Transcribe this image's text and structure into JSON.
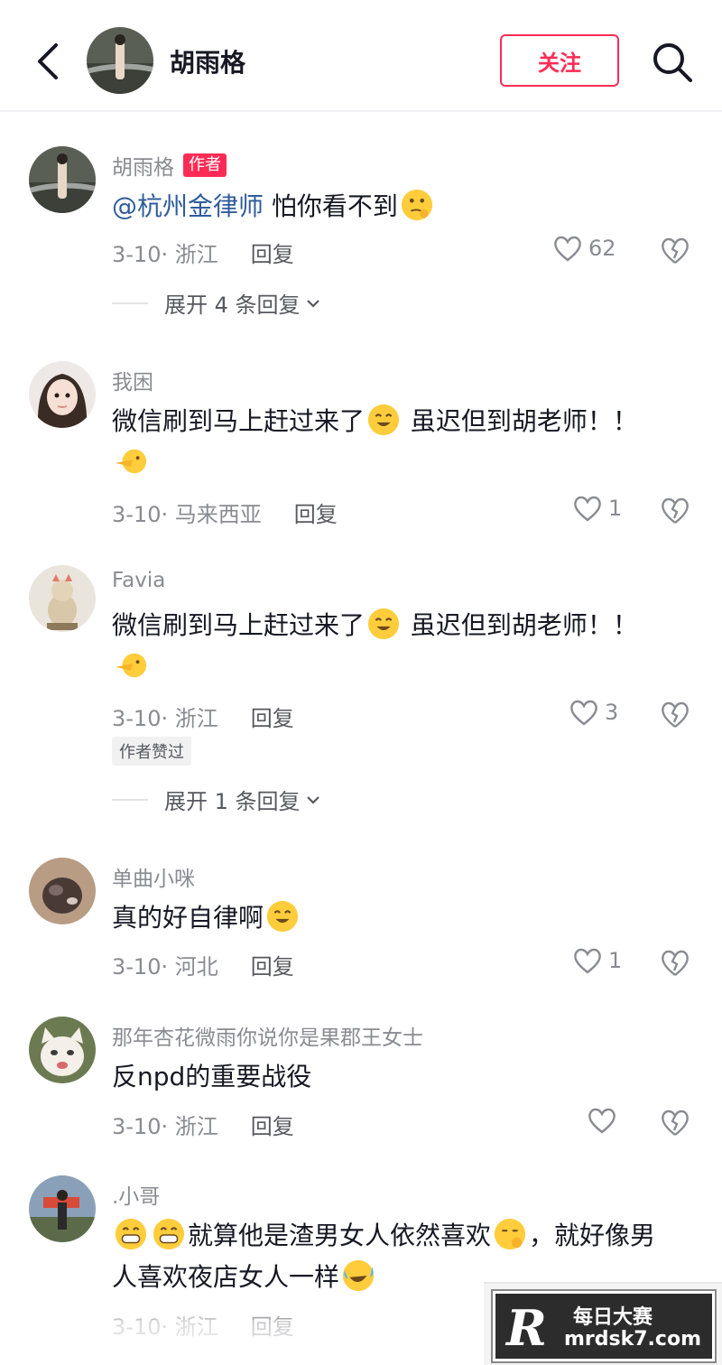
{
  "header": {
    "title": "胡雨格",
    "follow_label": "关注"
  },
  "comments": [
    {
      "username": "胡雨格",
      "author_tag": "作者",
      "mention": "@杭州金律师",
      "text": " 怕你看不到",
      "date_location": "3-10· 浙江",
      "reply_label": "回复",
      "likes": "62",
      "expand_label": "展开 4 条回复"
    },
    {
      "username": "我困",
      "text": "微信刷到马上赶过来了",
      "text2": " 虽迟但到胡老师！！",
      "date_location": "3-10· 马来西亚",
      "reply_label": "回复",
      "likes": "1"
    },
    {
      "username": "Favia",
      "text": "微信刷到马上赶过来了",
      "text2": " 虽迟但到胡老师！！",
      "date_location": "3-10· 浙江",
      "reply_label": "回复",
      "likes": "3",
      "liked_tag": "作者赞过",
      "expand_label": "展开 1 条回复"
    },
    {
      "username": "单曲小咪",
      "text": "真的好自律啊",
      "date_location": "3-10· 河北",
      "reply_label": "回复",
      "likes": "1"
    },
    {
      "username": "那年杏花微雨你说你是果郡王女士",
      "text": "反npd的重要战役",
      "date_location": "3-10· 浙江",
      "reply_label": "回复",
      "likes": ""
    },
    {
      "username": ".小哥",
      "text_a": "就算他是渣男女人依然喜欢",
      "text_b": "，就好像男人喜欢夜店女人一样",
      "date_location": "3-10· 浙江",
      "reply_label": "回复"
    }
  ],
  "watermark": {
    "logo": "R",
    "cn": "每日大赛",
    "url": "mrdsk7.com"
  },
  "colors": {
    "accent": "#fe2c55",
    "mention": "#2f5c9b",
    "muted": "#8a8b91"
  }
}
